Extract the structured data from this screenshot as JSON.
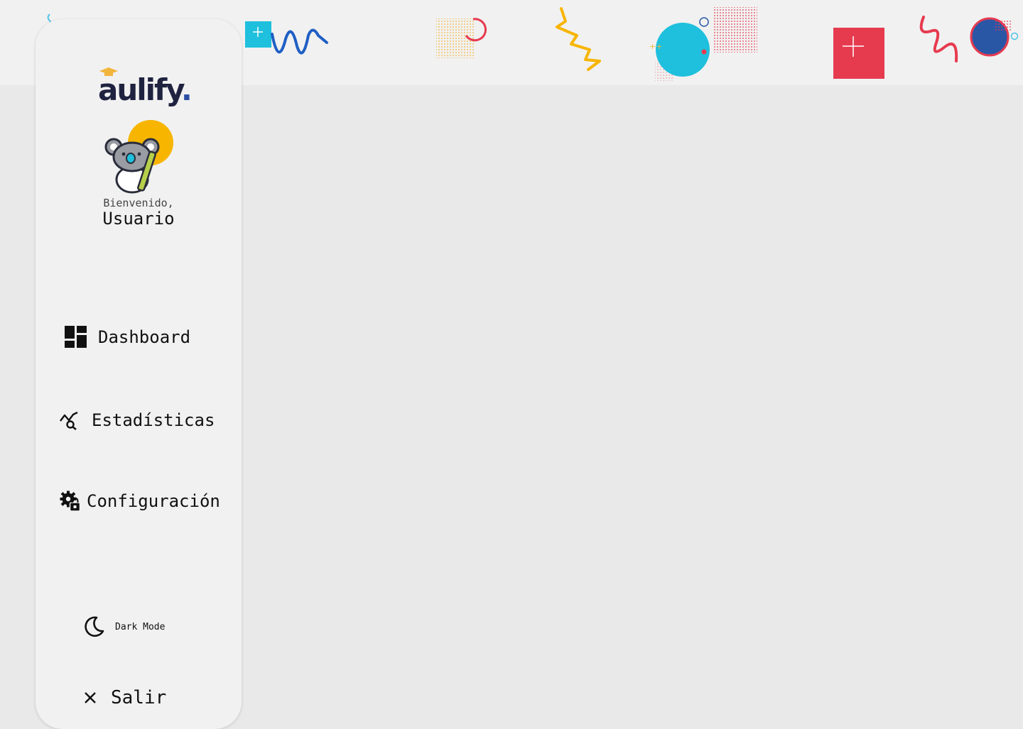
{
  "brand": {
    "name": "aulify",
    "dot": "."
  },
  "user": {
    "greeting": "Bienvenido,",
    "name": "Usuario"
  },
  "nav": {
    "dashboard": {
      "label": "Dashboard",
      "icon": "dashboard-icon"
    },
    "stats": {
      "label": "Estadísticas",
      "icon": "stats-search-icon"
    },
    "config": {
      "label": "Configuración",
      "icon": "settings-lock-icon"
    }
  },
  "footer": {
    "dark_mode": {
      "label": "Dark Mode",
      "icon": "moon-icon"
    },
    "logout": {
      "label": "Salir",
      "icon": "close-icon"
    }
  },
  "colors": {
    "accent_cyan": "#1ec0dd",
    "accent_red": "#e63b4f",
    "accent_yellow": "#f7b500",
    "accent_blue": "#2a56a6",
    "brand_dark": "#1f2340"
  }
}
